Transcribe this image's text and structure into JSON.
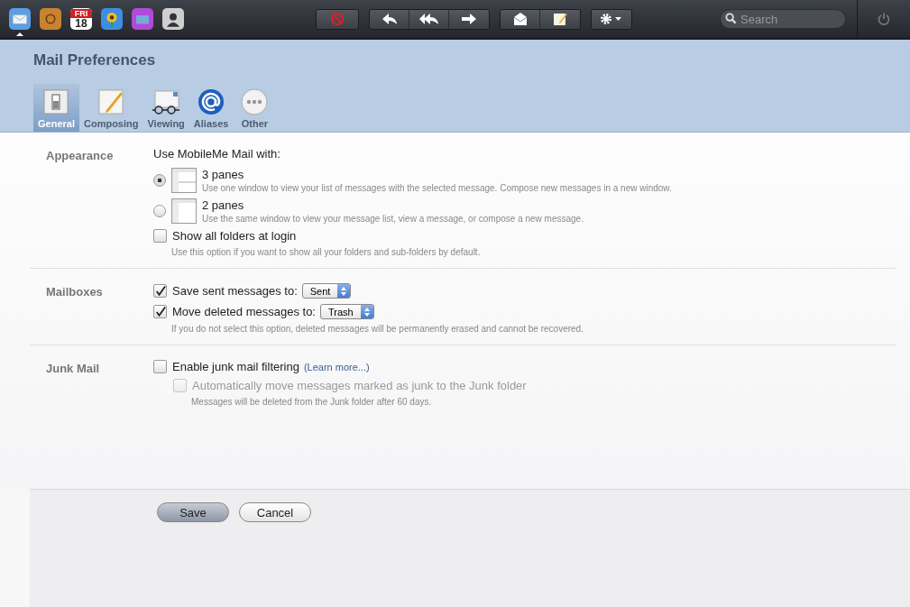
{
  "dock": [
    {
      "kind": "mail",
      "selected": true
    },
    {
      "kind": "addressbook",
      "selected": false
    },
    {
      "kind": "calendar",
      "selected": false,
      "day": "FRI",
      "date": "18"
    },
    {
      "kind": "photos",
      "selected": false
    },
    {
      "kind": "files",
      "selected": false
    },
    {
      "kind": "contacts",
      "selected": false
    }
  ],
  "search": {
    "placeholder": "Search"
  },
  "title": "Mail Preferences",
  "tabs": [
    {
      "label": "General",
      "kind": "general",
      "selected": true
    },
    {
      "label": "Composing",
      "kind": "composing",
      "selected": false
    },
    {
      "label": "Viewing",
      "kind": "viewing",
      "selected": false
    },
    {
      "label": "Aliases",
      "kind": "aliases",
      "selected": false
    },
    {
      "label": "Other",
      "kind": "other",
      "selected": false
    }
  ],
  "sections": [
    {
      "label": "Appearance",
      "intro": "Use MobileMe Mail with:",
      "items": [
        {
          "kind": "threepane",
          "label": "3 panes",
          "selected": true,
          "note": "Use one window to view your list of messages with the selected message. Compose new messages in a new window."
        },
        {
          "kind": "twopane",
          "label": "2 panes",
          "selected": false,
          "note": "Use the same window to view your message list, view a message, or compose a new message."
        },
        {
          "kind": "checkbox",
          "label": "Show all folders at login",
          "checked": false,
          "disabled": false,
          "note": "Use this option if you want to show all your folders and sub-folders by default."
        }
      ]
    },
    {
      "label": "Mailboxes",
      "items": [
        {
          "kind": "checkbox",
          "label": "Save sent messages to:",
          "checked": true,
          "disabled": false,
          "select": "Sent"
        },
        {
          "kind": "checkbox",
          "label": "Move deleted messages to:",
          "checked": true,
          "disabled": false,
          "select": "Trash",
          "note": "If you do not select this option, deleted messages will be permanently erased and cannot be recovered."
        }
      ]
    },
    {
      "label": "Junk Mail",
      "items": [
        {
          "kind": "checkbox",
          "label": "Enable junk mail filtering",
          "checked": false,
          "disabled": false,
          "link": "(Learn more...)",
          "children": [
            {
              "kind": "checkbox",
              "label": "Automatically move messages marked as junk to the Junk folder",
              "checked": false,
              "disabled": true,
              "note": "Messages will be deleted from the Junk folder after 60 days."
            }
          ]
        }
      ]
    }
  ],
  "buttons": [
    {
      "label": "Save",
      "kind": "primary"
    },
    {
      "label": "Cancel",
      "kind": "secondary"
    }
  ]
}
